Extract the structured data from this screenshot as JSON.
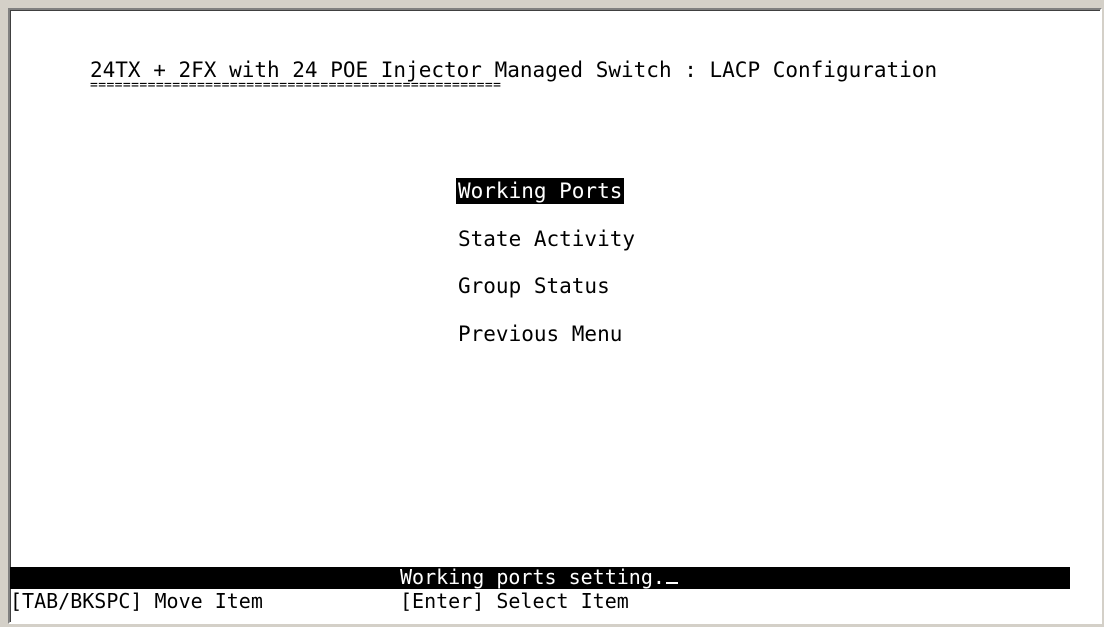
{
  "screen": {
    "title": "24TX + 2FX with 24 POE Injector Managed Switch : LACP Configuration",
    "title_underline": "=================================================="
  },
  "menu": {
    "items": [
      {
        "label": "Working Ports",
        "selected": true
      },
      {
        "label": "State Activity",
        "selected": false
      },
      {
        "label": "Group Status",
        "selected": false
      },
      {
        "label": "Previous Menu",
        "selected": false
      }
    ]
  },
  "status": {
    "message": "Working ports setting."
  },
  "help": {
    "move": "[TAB/BKSPC] Move Item",
    "select": "[Enter] Select Item"
  }
}
